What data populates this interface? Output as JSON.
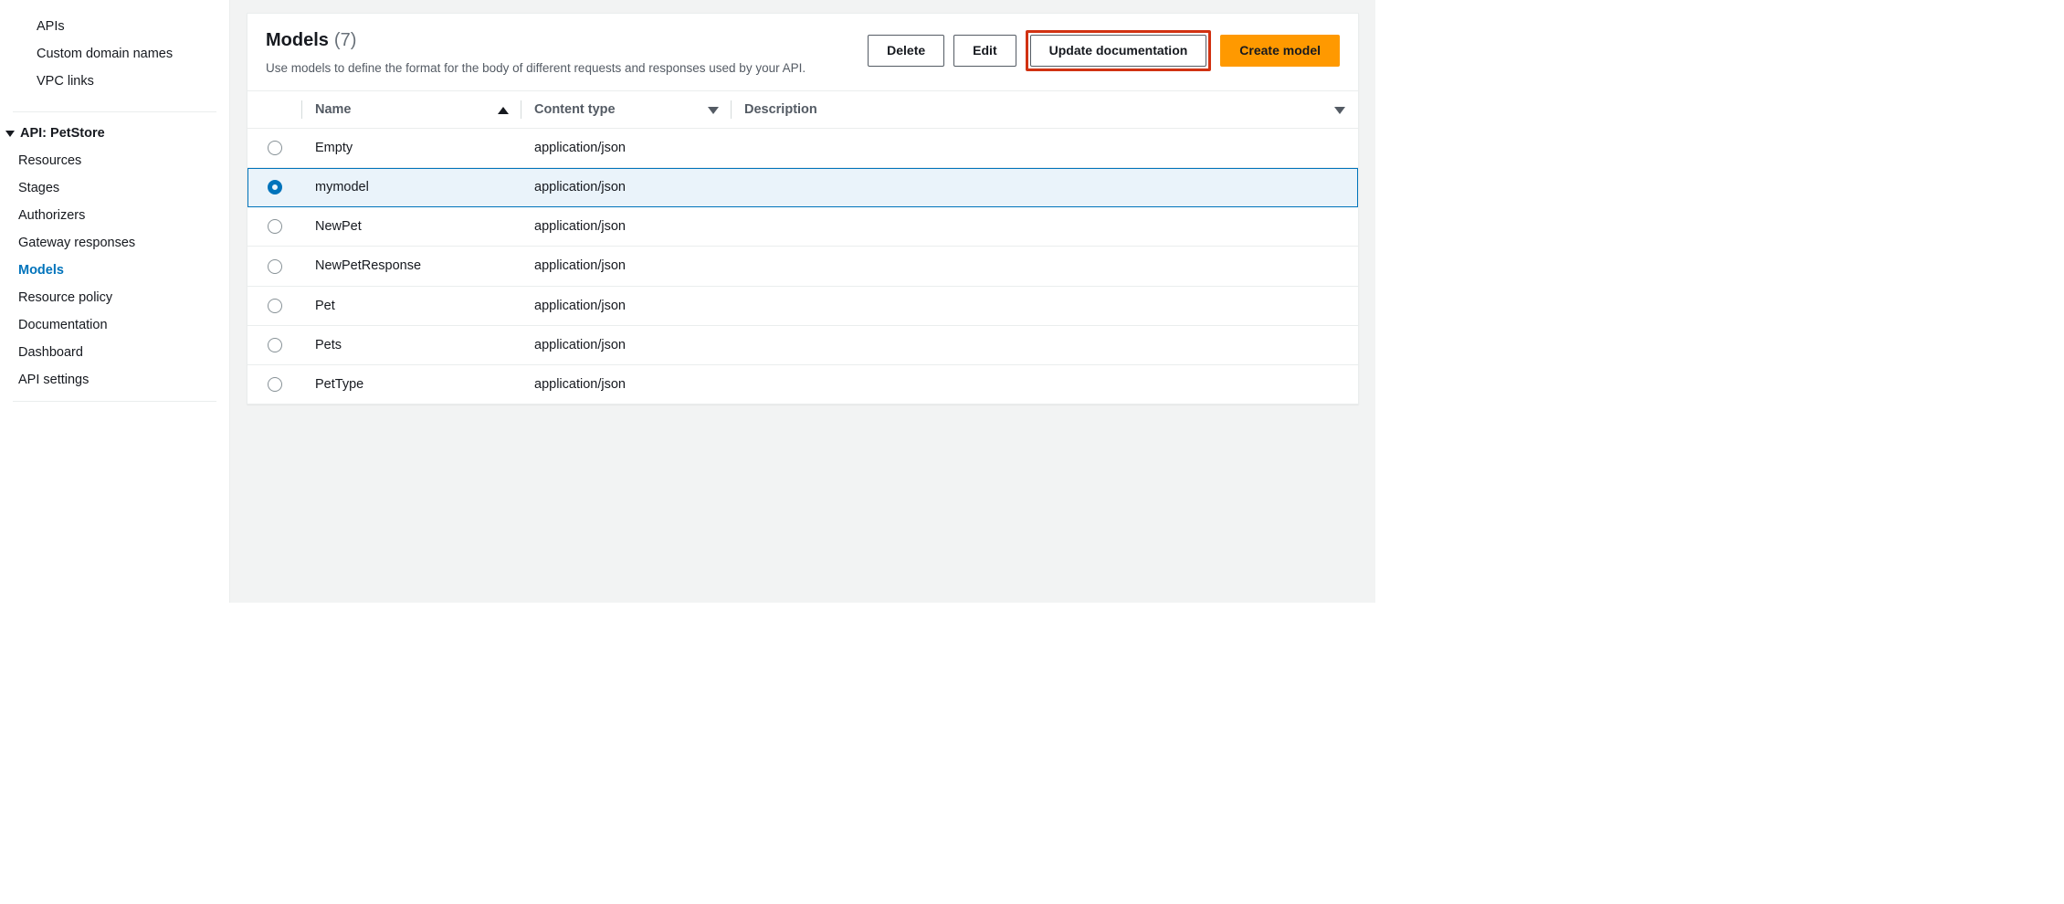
{
  "sidebar": {
    "top_items": [
      {
        "label": "APIs",
        "name": "sidebar-item-apis"
      },
      {
        "label": "Custom domain names",
        "name": "sidebar-item-custom-domain-names"
      },
      {
        "label": "VPC links",
        "name": "sidebar-item-vpc-links"
      }
    ],
    "api_heading": "API: PetStore",
    "api_items": [
      {
        "label": "Resources",
        "name": "sidebar-item-resources",
        "active": false
      },
      {
        "label": "Stages",
        "name": "sidebar-item-stages",
        "active": false
      },
      {
        "label": "Authorizers",
        "name": "sidebar-item-authorizers",
        "active": false
      },
      {
        "label": "Gateway responses",
        "name": "sidebar-item-gateway-responses",
        "active": false
      },
      {
        "label": "Models",
        "name": "sidebar-item-models",
        "active": true
      },
      {
        "label": "Resource policy",
        "name": "sidebar-item-resource-policy",
        "active": false
      },
      {
        "label": "Documentation",
        "name": "sidebar-item-documentation",
        "active": false
      },
      {
        "label": "Dashboard",
        "name": "sidebar-item-dashboard",
        "active": false
      },
      {
        "label": "API settings",
        "name": "sidebar-item-api-settings",
        "active": false
      }
    ]
  },
  "header": {
    "title": "Models",
    "count": "(7)",
    "description": "Use models to define the format for the body of different requests and responses used by your API.",
    "buttons": {
      "delete": "Delete",
      "edit": "Edit",
      "update_doc": "Update documentation",
      "create": "Create model"
    }
  },
  "table": {
    "columns": {
      "name": "Name",
      "content_type": "Content type",
      "description": "Description"
    },
    "rows": [
      {
        "name": "Empty",
        "content_type": "application/json",
        "description": "",
        "selected": false
      },
      {
        "name": "mymodel",
        "content_type": "application/json",
        "description": "",
        "selected": true
      },
      {
        "name": "NewPet",
        "content_type": "application/json",
        "description": "",
        "selected": false
      },
      {
        "name": "NewPetResponse",
        "content_type": "application/json",
        "description": "",
        "selected": false
      },
      {
        "name": "Pet",
        "content_type": "application/json",
        "description": "",
        "selected": false
      },
      {
        "name": "Pets",
        "content_type": "application/json",
        "description": "",
        "selected": false
      },
      {
        "name": "PetType",
        "content_type": "application/json",
        "description": "",
        "selected": false
      }
    ]
  }
}
